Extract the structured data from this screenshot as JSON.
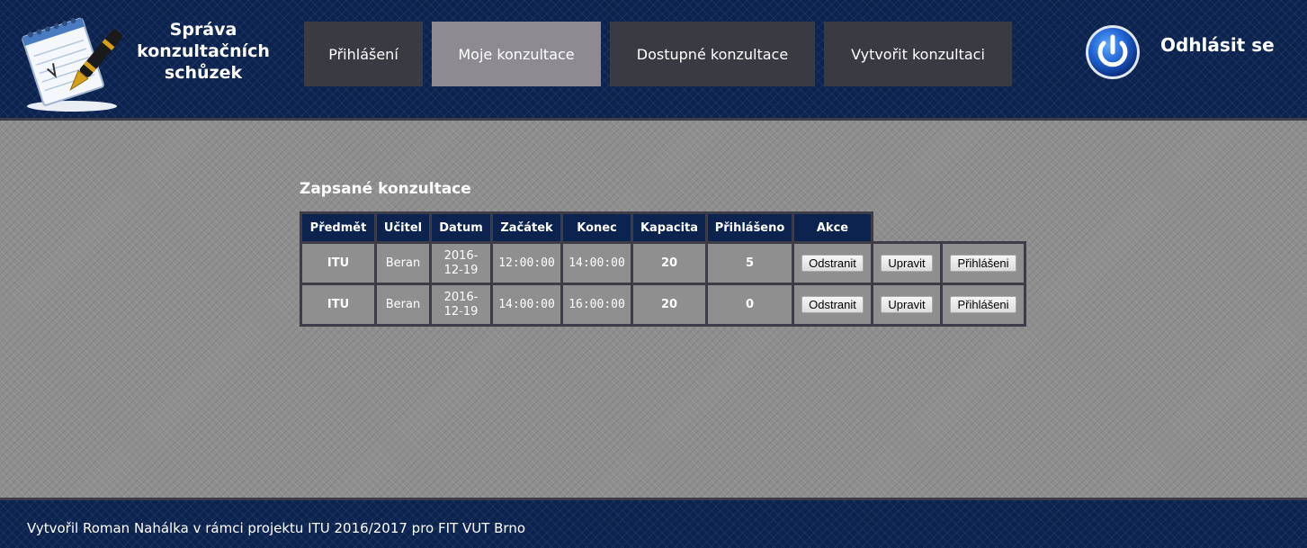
{
  "header": {
    "app_title": "Správa konzultačních schůzek",
    "nav": [
      {
        "label": "Přihlášení",
        "active": false
      },
      {
        "label": "Moje konzultace",
        "active": true
      },
      {
        "label": "Dostupné konzultace",
        "active": false
      },
      {
        "label": "Vytvořit konzultaci",
        "active": false
      }
    ],
    "logout_label": "Odhlásit se",
    "logout_icon": "power-icon",
    "logo_icon": "notepad-pen-icon"
  },
  "main": {
    "section_title": "Zapsané konzultace",
    "table": {
      "columns": [
        "Předmět",
        "Učitel",
        "Datum",
        "Začátek",
        "Konec",
        "Kapacita",
        "Přihlášeno",
        "Akce"
      ],
      "rows": [
        {
          "predmet": "ITU",
          "ucitel": "Beran",
          "datum": "2016-12-19",
          "zacatek": "12:00:00",
          "konec": "14:00:00",
          "kapacita": "20",
          "prihlaseno": "5"
        },
        {
          "predmet": "ITU",
          "ucitel": "Beran",
          "datum": "2016-12-19",
          "zacatek": "14:00:00",
          "konec": "16:00:00",
          "kapacita": "20",
          "prihlaseno": "0"
        }
      ],
      "actions": {
        "remove": "Odstranit",
        "edit": "Upravit",
        "signups": "Přihlášeni"
      }
    }
  },
  "footer": {
    "text": "Vytvořil Roman Nahálka v rámci projektu ITU 2016/2017 pro FIT VUT Brno"
  },
  "colors": {
    "header_bg": "#0c2350",
    "nav_bg": "#3a3a43",
    "nav_active_bg": "#8d8b91",
    "page_bg": "#8e8e8e",
    "table_header_bg": "#0c2350",
    "table_border": "#3d3d47"
  }
}
